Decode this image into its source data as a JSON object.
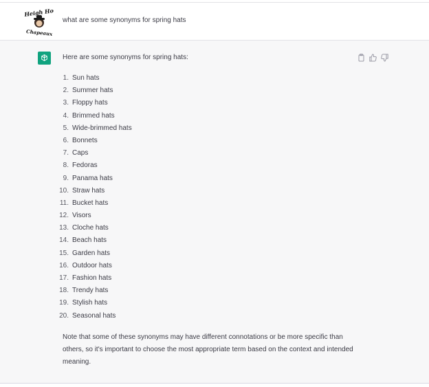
{
  "user_message": {
    "avatar_text_top": "Heigh Ho",
    "avatar_text_bottom": "Chapeaux",
    "text": "what are some synonyms for spring hats"
  },
  "assistant_message": {
    "intro": "Here are some synonyms for spring hats:",
    "items": [
      {
        "num": "1.",
        "text": "Sun hats"
      },
      {
        "num": "2.",
        "text": "Summer hats"
      },
      {
        "num": "3.",
        "text": "Floppy hats"
      },
      {
        "num": "4.",
        "text": "Brimmed hats"
      },
      {
        "num": "5.",
        "text": "Wide-brimmed hats"
      },
      {
        "num": "6.",
        "text": "Bonnets"
      },
      {
        "num": "7.",
        "text": "Caps"
      },
      {
        "num": "8.",
        "text": "Fedoras"
      },
      {
        "num": "9.",
        "text": "Panama hats"
      },
      {
        "num": "10.",
        "text": "Straw hats"
      },
      {
        "num": "11.",
        "text": "Bucket hats"
      },
      {
        "num": "12.",
        "text": "Visors"
      },
      {
        "num": "13.",
        "text": "Cloche hats"
      },
      {
        "num": "14.",
        "text": "Beach hats"
      },
      {
        "num": "15.",
        "text": "Garden hats"
      },
      {
        "num": "16.",
        "text": "Outdoor hats"
      },
      {
        "num": "17.",
        "text": "Fashion hats"
      },
      {
        "num": "18.",
        "text": "Trendy hats"
      },
      {
        "num": "19.",
        "text": "Stylish hats"
      },
      {
        "num": "20.",
        "text": "Seasonal hats"
      }
    ],
    "note": "Note that some of these synonyms may have different connotations or be more specific than others, so it's important to choose the most appropriate term based on the context and intended meaning."
  },
  "icons": {
    "copy": "clipboard-icon",
    "like": "thumbs-up-icon",
    "dislike": "thumbs-down-icon",
    "assistant": "openai-logo-icon"
  },
  "colors": {
    "assistant_bg": "#f7f7f8",
    "brand_green": "#10a37f"
  }
}
